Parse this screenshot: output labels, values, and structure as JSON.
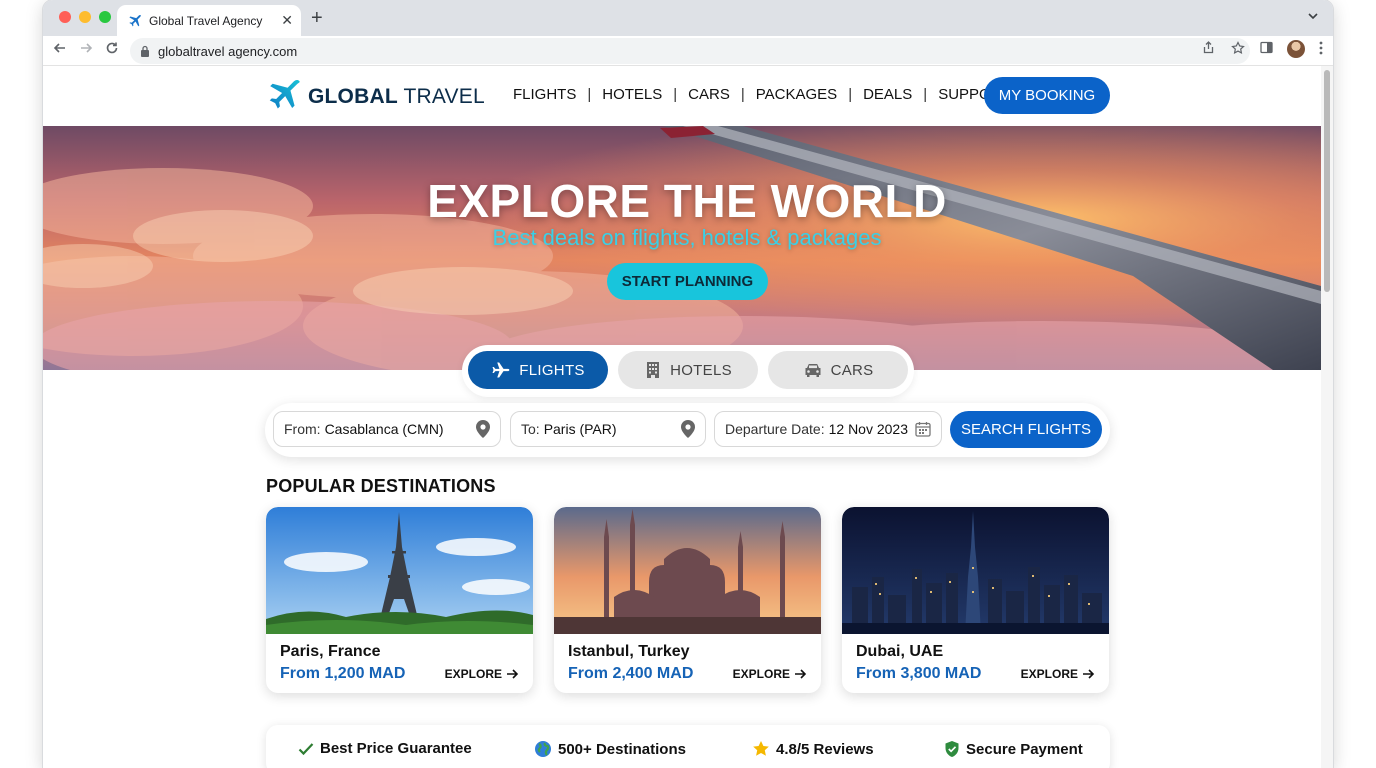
{
  "browser": {
    "tab_title": "Global Travel Agency",
    "url": "globaltravel agency.com",
    "new_tab_glyph": "+",
    "tab_close_glyph": "✕"
  },
  "header": {
    "logo_bold": "GLOBAL",
    "logo_light": "TRAVEL",
    "nav": [
      "FLIGHTS",
      "HOTELS",
      "CARS",
      "PACKAGES",
      "DEALS",
      "SUPPORT"
    ],
    "separator": "|",
    "booking_button": "MY BOOKING"
  },
  "hero": {
    "title": "EXPLORE THE WORLD",
    "subtitle": "Best deals on flights, hotels & packages",
    "cta": "START PLANNING"
  },
  "mode_tabs": [
    {
      "label": "FLIGHTS",
      "icon": "plane-icon",
      "active": true
    },
    {
      "label": "HOTELS",
      "icon": "building-icon",
      "active": false
    },
    {
      "label": "CARS",
      "icon": "car-icon",
      "active": false
    }
  ],
  "search": {
    "from_label": "From:",
    "from_value": "Casablanca (CMN)",
    "to_label": "To:",
    "to_value": "Paris (PAR)",
    "date_label": "Departure Date:",
    "date_value": "12 Nov 2023",
    "button": "SEARCH FLIGHTS"
  },
  "popular": {
    "title": "POPULAR DESTINATIONS",
    "cards": [
      {
        "name": "Paris, France",
        "price": "From 1,200 MAD",
        "explore": "EXPLORE"
      },
      {
        "name": "Istanbul, Turkey",
        "price": "From 2,400 MAD",
        "explore": "EXPLORE"
      },
      {
        "name": "Dubai, UAE",
        "price": "From 3,800 MAD",
        "explore": "EXPLORE"
      }
    ]
  },
  "features": [
    {
      "label": "Best Price Guarantee",
      "icon": "checkmark-icon"
    },
    {
      "label": "500+ Destinations",
      "icon": "globe-icon"
    },
    {
      "label": "4.8/5 Reviews",
      "icon": "star-icon"
    },
    {
      "label": "Secure Payment",
      "icon": "shield-icon"
    }
  ],
  "colors": {
    "primary_blue": "#0b63c9",
    "active_tab": "#0b5aa8",
    "accent_cyan": "#18c5dc",
    "price_blue": "#1663b6"
  }
}
